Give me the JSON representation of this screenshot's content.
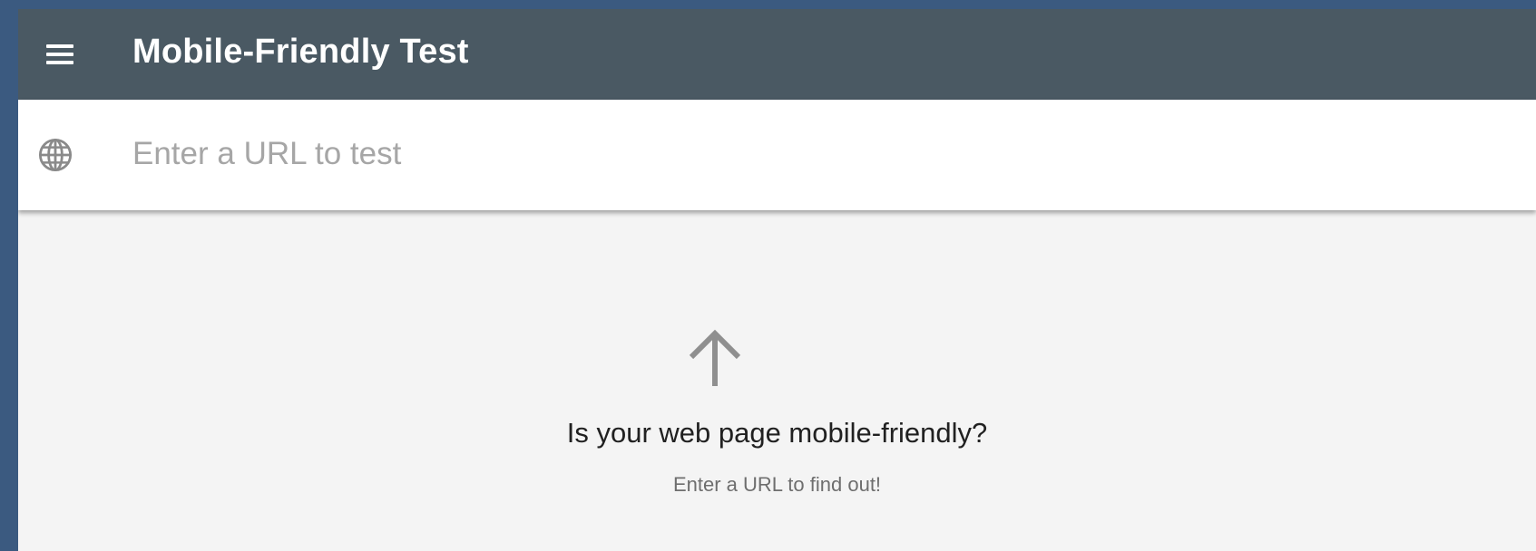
{
  "header": {
    "title": "Mobile-Friendly Test",
    "menu_icon": "hamburger-menu-icon",
    "background_color": "#4a5963"
  },
  "search": {
    "placeholder": "Enter a URL to test",
    "value": "",
    "icon": "globe-icon"
  },
  "main": {
    "icon": "arrow-up-icon",
    "headline": "Is your web page mobile-friendly?",
    "subline": "Enter a URL to find out!"
  },
  "colors": {
    "frame_border": "#3b5a80",
    "content_background": "#f4f4f4"
  }
}
